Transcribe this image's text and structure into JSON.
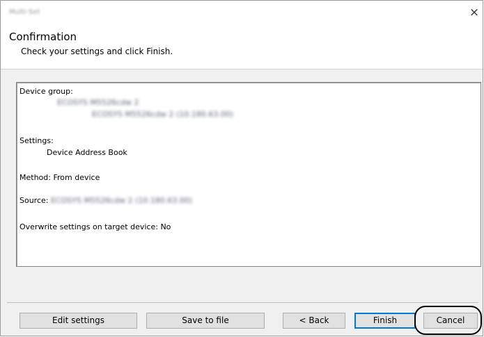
{
  "window": {
    "title": "Multi-Set",
    "close_glyph": "×"
  },
  "header": {
    "title": "Confirmation",
    "subtitle": "Check your settings and click Finish."
  },
  "summary": {
    "device_group_label": "Device group:",
    "device_group_line1": "ECOSYS M5526cdw 2",
    "device_group_line2": "ECOSYS M5526cdw 2 (10.180.63.00)",
    "settings_label": "Settings:",
    "settings_value": "Device Address Book",
    "method_text": "Method: From device",
    "source_label": "Source:",
    "source_value": "ECOSYS M5526cdw 2 (10.180.63.00)",
    "overwrite_text": "Overwrite settings on target device: No"
  },
  "buttons": {
    "edit_settings": "Edit settings",
    "save_to_file": "Save to file",
    "back": "< Back",
    "finish": "Finish",
    "cancel": "Cancel"
  },
  "colors": {
    "accent": "#0078d7",
    "button_face": "#e1e1e1",
    "dialog_background": "#f0f0f0"
  }
}
